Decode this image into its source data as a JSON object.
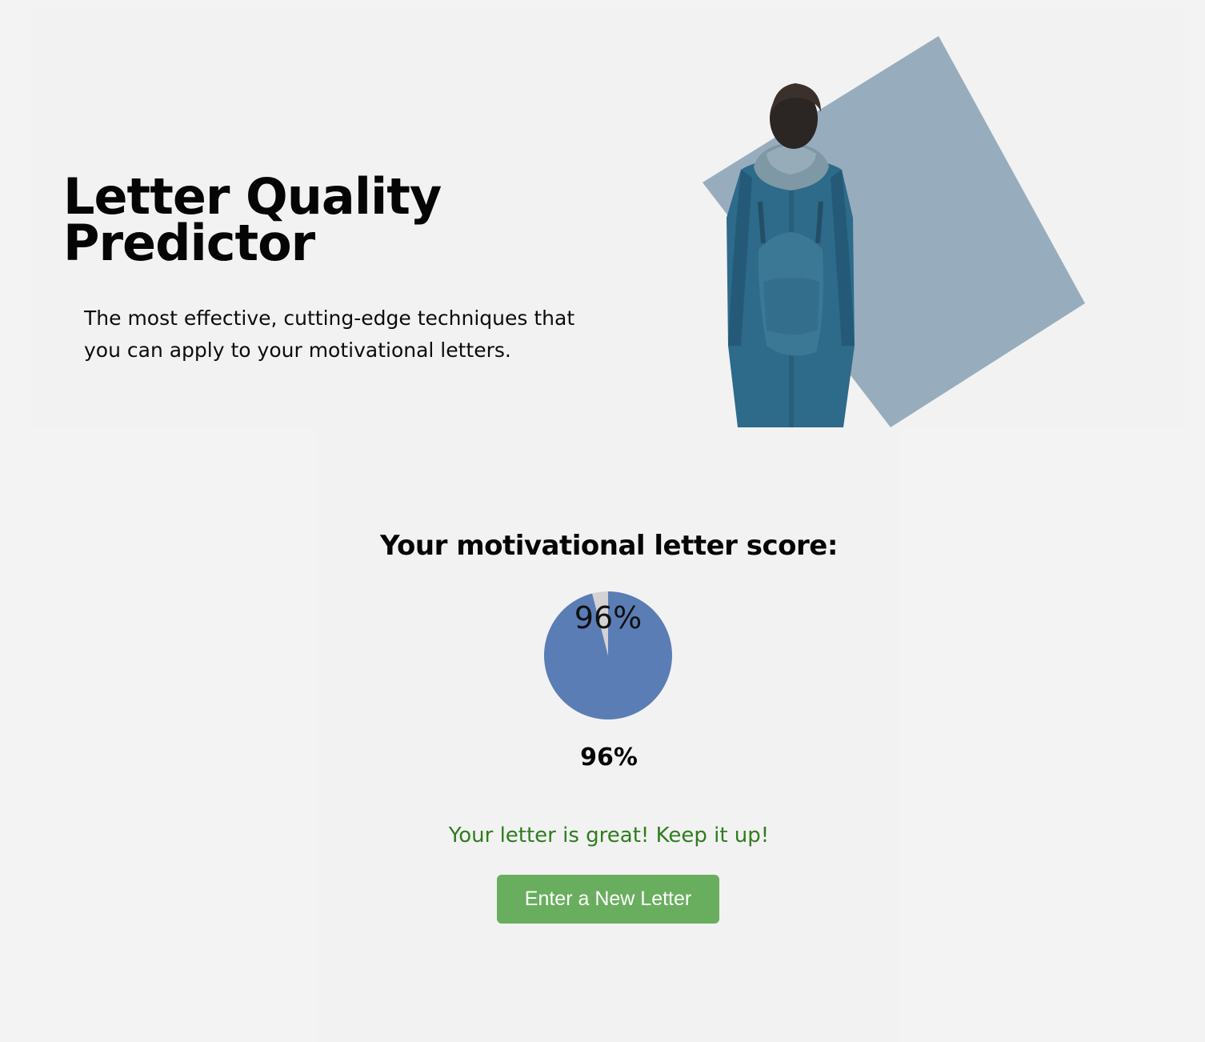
{
  "hero": {
    "title_line1": "Letter Quality",
    "title_line2": "Predictor",
    "subtitle": "The most effective, cutting-edge techniques that you can apply to your motivational letters."
  },
  "result": {
    "heading": "Your motivational letter score:",
    "score_label": "96%",
    "feedback": "Your letter is great! Keep it up!",
    "button_label": "Enter a New Letter"
  },
  "chart_data": {
    "type": "pie",
    "categories": [
      "score",
      "remaining"
    ],
    "values": [
      96,
      4
    ],
    "colors": [
      "#5a7db5",
      "#d3d3d3"
    ],
    "label": "96%"
  },
  "colors": {
    "pie_score": "#5a7db5",
    "pie_remaining": "#d3d3d3",
    "feedback_green": "#2f7d1e",
    "button_green": "#69ae5e",
    "hero_square": "#97adbd"
  }
}
